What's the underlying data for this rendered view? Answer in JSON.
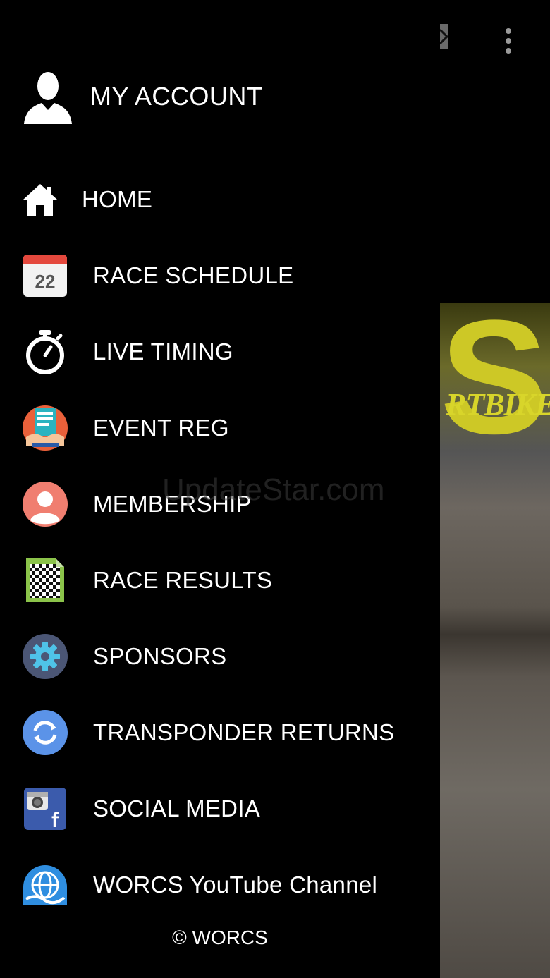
{
  "account": {
    "label": "MY ACCOUNT"
  },
  "menu": {
    "items": [
      {
        "label": "HOME",
        "icon": "home-icon"
      },
      {
        "label": "RACE SCHEDULE",
        "icon": "calendar-icon",
        "icon_text": "22"
      },
      {
        "label": "LIVE TIMING",
        "icon": "stopwatch-icon"
      },
      {
        "label": "EVENT REG",
        "icon": "registration-icon"
      },
      {
        "label": "MEMBERSHIP",
        "icon": "user-circle-icon"
      },
      {
        "label": "RACE RESULTS",
        "icon": "checkered-flag-icon"
      },
      {
        "label": "SPONSORS",
        "icon": "gear-icon"
      },
      {
        "label": "TRANSPONDER RETURNS",
        "icon": "refresh-icon"
      },
      {
        "label": "SOCIAL MEDIA",
        "icon": "social-media-icon",
        "icon_text": "f"
      },
      {
        "label": "WORCS YouTube Channel",
        "icon": "globe-icon"
      }
    ]
  },
  "footer": {
    "text": "© WORCS"
  },
  "background": {
    "brand_text": "S",
    "subtitle": "RTBIKE"
  },
  "watermark": "UpdateStar.com",
  "colors": {
    "brand_yellow": "#cdc826",
    "drawer_bg": "#000000"
  }
}
